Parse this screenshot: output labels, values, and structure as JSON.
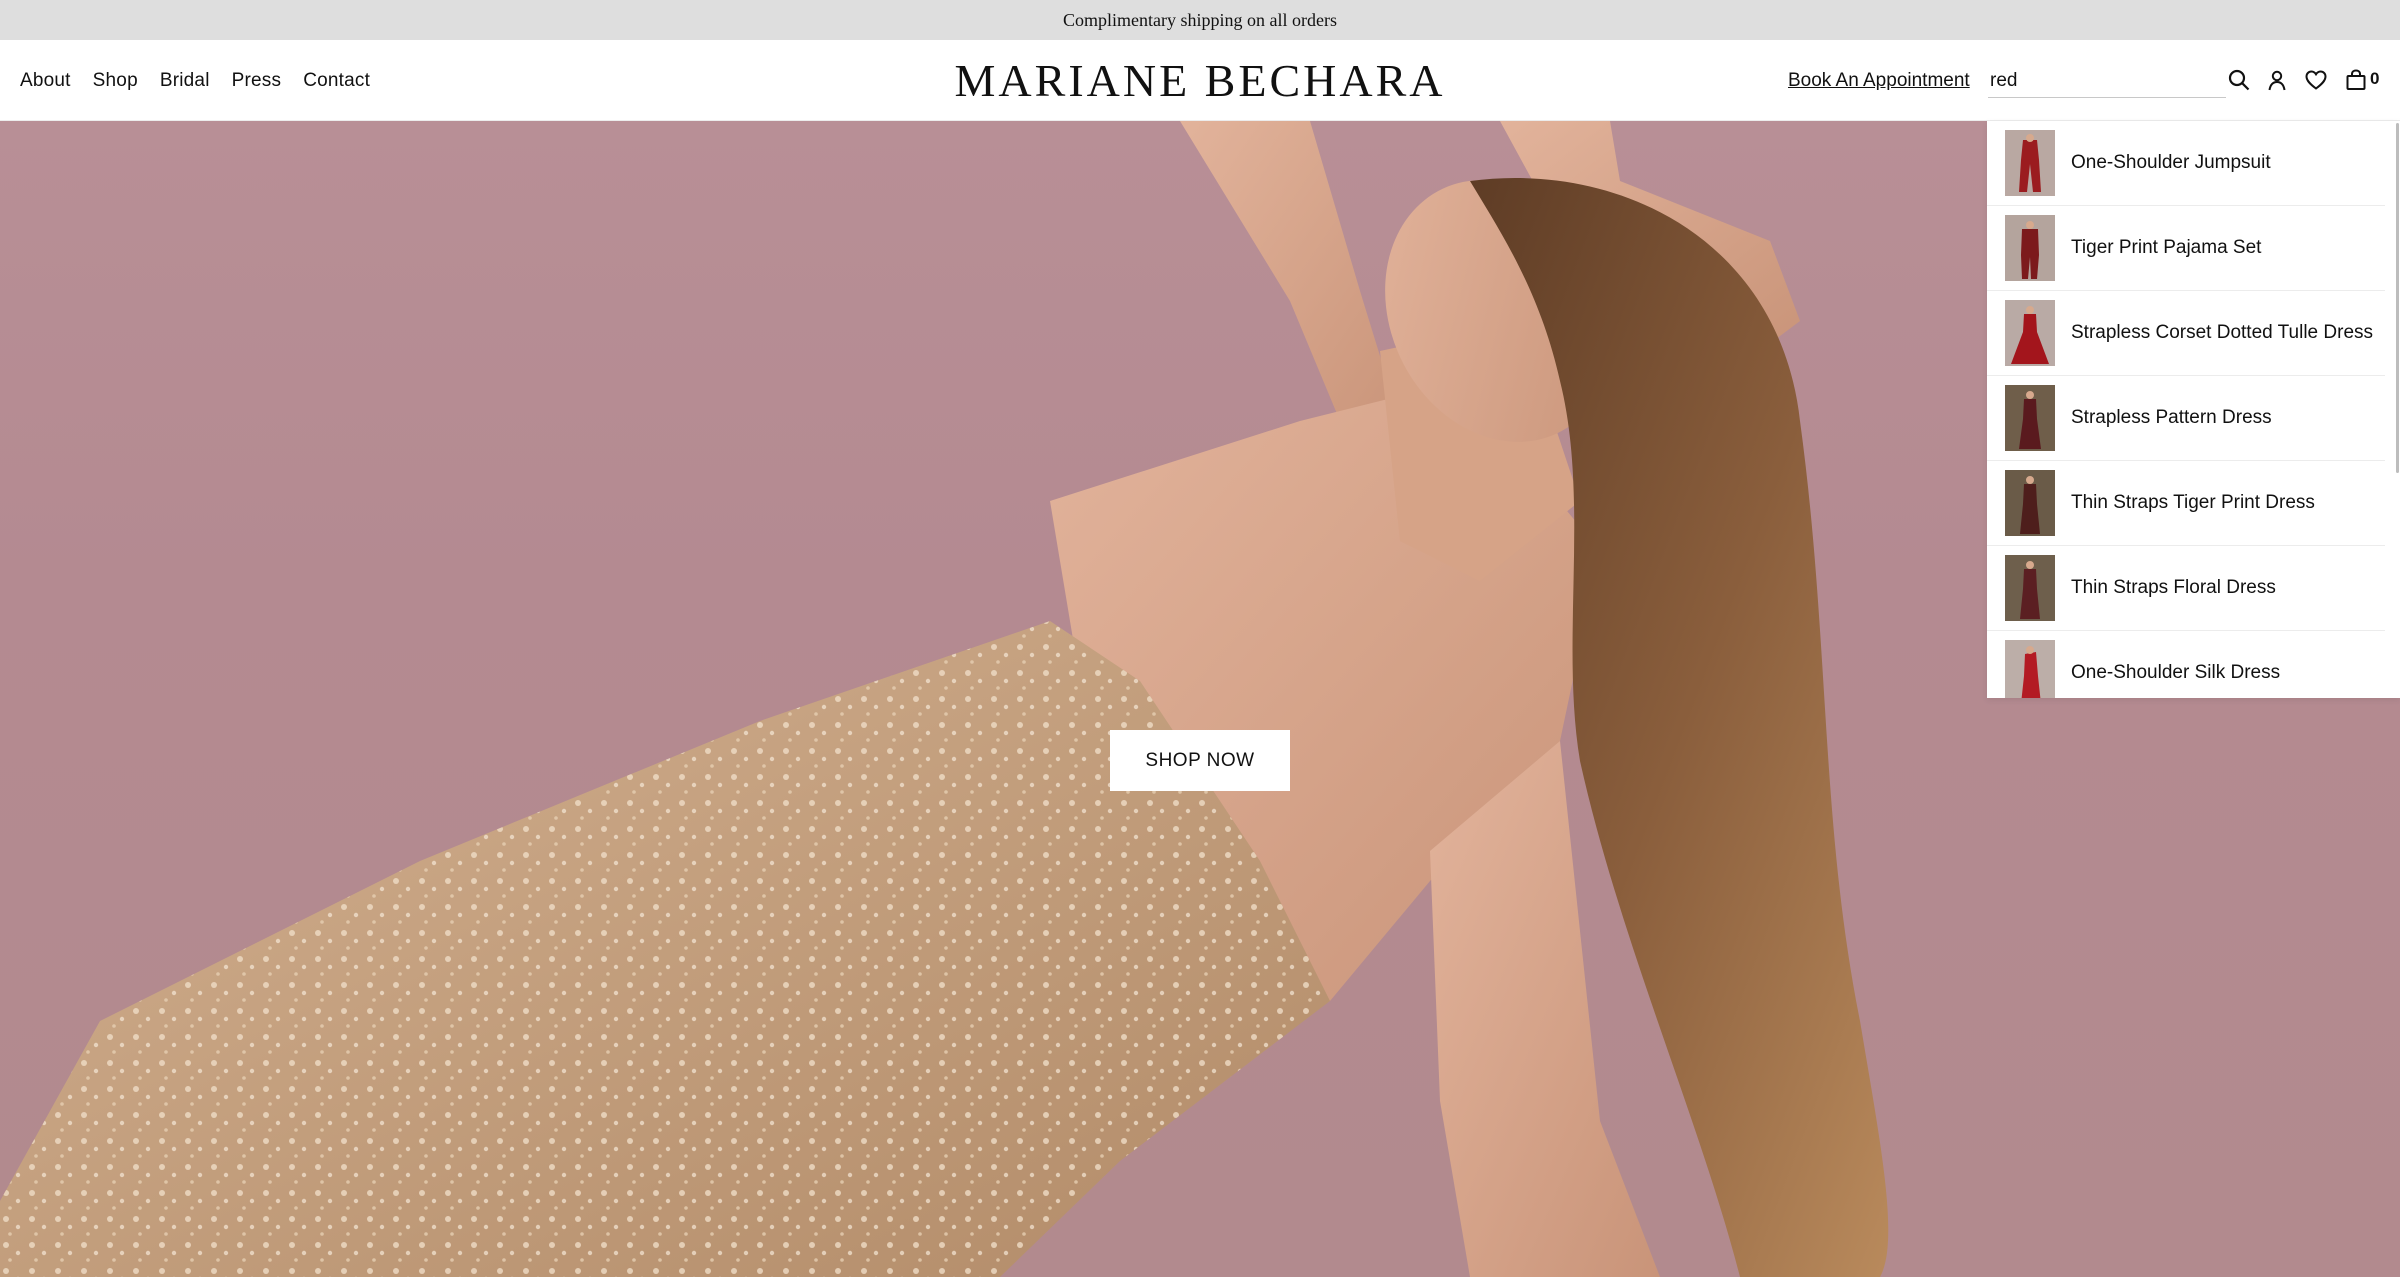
{
  "announcement": "Complimentary shipping on all orders",
  "nav": {
    "items": [
      {
        "label": "About"
      },
      {
        "label": "Shop"
      },
      {
        "label": "Bridal"
      },
      {
        "label": "Press"
      },
      {
        "label": "Contact"
      }
    ]
  },
  "brand": {
    "logo_text": "MARIANE BECHARA"
  },
  "header": {
    "appointment_label": "Book An Appointment",
    "search_value": "red",
    "cart_count": "0",
    "icons": [
      "search-icon",
      "account-icon",
      "wishlist-heart-icon",
      "cart-bag-icon"
    ]
  },
  "hero": {
    "cta_label": "SHOP NOW"
  },
  "search_results": [
    {
      "label": "One-Shoulder Jumpsuit",
      "thumb_color": "#9b1c1f"
    },
    {
      "label": "Tiger Print Pajama Set",
      "thumb_color": "#7c1a1c"
    },
    {
      "label": "Strapless Corset Dotted Tulle Dress",
      "thumb_color": "#a3151c"
    },
    {
      "label": "Strapless Pattern Dress",
      "thumb_color": "#5a1a1e"
    },
    {
      "label": "Thin Straps Tiger Print Dress",
      "thumb_color": "#4e1e1c"
    },
    {
      "label": "Thin Straps Floral Dress",
      "thumb_color": "#5b1f22"
    },
    {
      "label": "One-Shoulder Silk Dress",
      "thumb_color": "#b31b24"
    }
  ],
  "colors": {
    "announcement_bg": "#dedede",
    "hero_bg": "#b88f96",
    "dress": "#c4a080",
    "hair": "#7a5236",
    "skin": "#d9a98f"
  }
}
